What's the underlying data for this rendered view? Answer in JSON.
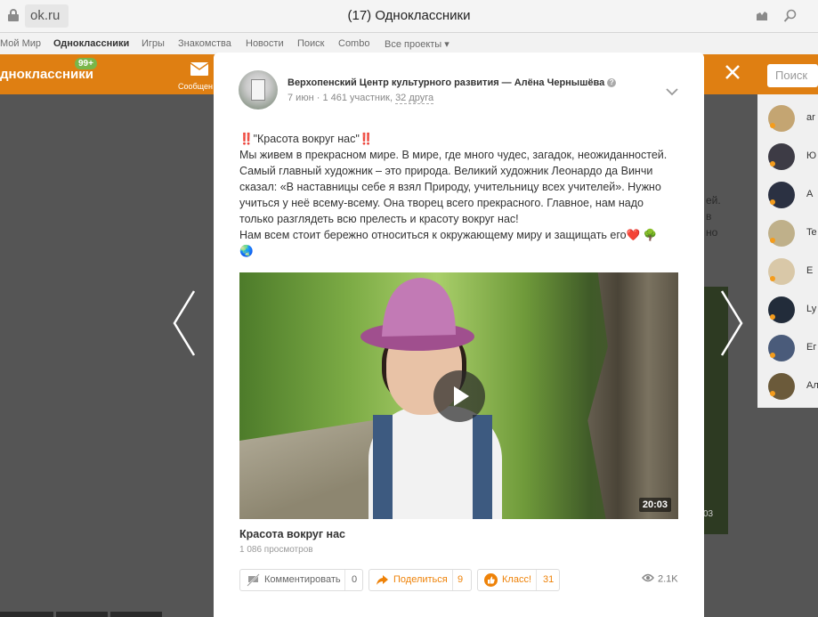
{
  "browser": {
    "url": "ok.ru",
    "tab_title": "(17) Одноклассники"
  },
  "site_nav": {
    "items": [
      "Мой Мир",
      "Одноклассники",
      "Игры",
      "Знакомства",
      "Новости",
      "Поиск",
      "Combo",
      "Все проекты ▾"
    ]
  },
  "header": {
    "logo": "дноклассники",
    "badge": "99+",
    "messages_label": "Сообщен",
    "search_placeholder": "Поиск"
  },
  "background": {
    "friend_names": [
      "ar",
      "Ю",
      "А",
      "Te",
      "Е",
      "Ly",
      "Ег",
      "Ал"
    ],
    "text_fragments": [
      "ей.",
      "в",
      "но"
    ],
    "video_time_fragment": "03"
  },
  "post": {
    "author": "Верхопенский Центр культурного развития — Алёна Чернышёва",
    "date": "7 июн",
    "members": "1 461 участник,",
    "friends": "32 друга",
    "text_lines": [
      "‼️\"Красота вокруг нас\"‼️",
      "Мы живем в прекрасном мире. В мире, где много чудес, загадок, неожиданностей.",
      "Самый главный художник – это природа. Великий художник Леонардо да Винчи",
      "сказал: «В наставницы себе я взял Природу, учительницу всех учителей». Нужно",
      "учиться у неё всему-всему. Она творец всего прекрасного. Главное, нам надо",
      "только разглядеть всю прелесть и красоту вокруг нас!",
      "Нам всем стоит бережно относиться к окружающему миру и защищать его❤️ 🌳",
      "🌏"
    ],
    "video": {
      "duration": "20:03",
      "title": "Красота вокруг нас",
      "views": "1 086 просмотров"
    },
    "actions": {
      "comment_label": "Комментировать",
      "comment_count": "0",
      "share_label": "Поделиться",
      "share_count": "9",
      "like_label": "Класс!",
      "like_count": "31",
      "total_views": "2.1K"
    }
  },
  "colors": {
    "accent_orange": "#df7f12",
    "share_orange": "#ee8208",
    "overlay": "#555555"
  },
  "icons": [
    "lock-icon",
    "bookmark-icon",
    "search-icon",
    "envelope-icon",
    "close-icon",
    "arrow-left-icon",
    "arrow-right-icon",
    "chevron-down-icon",
    "info-icon",
    "play-icon",
    "comment-off-icon",
    "share-arrow-icon",
    "like-icon",
    "eye-icon"
  ]
}
